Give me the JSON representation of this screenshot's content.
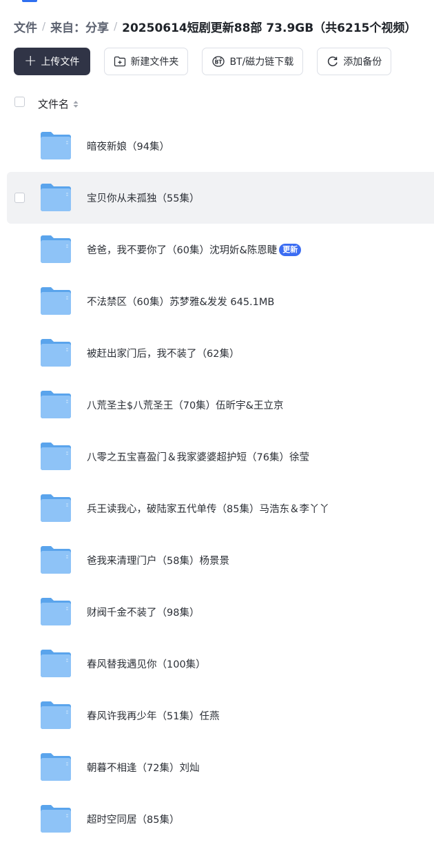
{
  "breadcrumb": {
    "root": "文件",
    "parent": "来自：分享",
    "current": "20250614短剧更新88部 73.9GB（共6215个视频）",
    "separator": "/"
  },
  "toolbar": {
    "upload_label": "上传文件",
    "new_folder_label": "新建文件夹",
    "bt_download_label": "BT/磁力链下载",
    "backup_label": "添加备份"
  },
  "list_header": {
    "name_label": "文件名"
  },
  "colors": {
    "folder": "#5aa4ec",
    "accent": "#2f6ff0",
    "primary_button": "#303446",
    "badge": "#3b6cf2"
  },
  "files": [
    {
      "name": "暗夜新娘（94集）",
      "badge": ""
    },
    {
      "name": "宝贝你从未孤独（55集）",
      "badge": ""
    },
    {
      "name": "爸爸，我不要你了（60集）沈玥妡&陈恩睫",
      "badge": "更新"
    },
    {
      "name": "不法禁区（60集）苏梦雅&发发 645.1MB",
      "badge": ""
    },
    {
      "name": "被赶出家门后，我不装了（62集）",
      "badge": ""
    },
    {
      "name": "八荒圣主$八荒圣王（70集）伍昕宇&王立京",
      "badge": ""
    },
    {
      "name": "八零之五宝喜盈门＆我家婆婆超护短（76集）徐莹",
      "badge": ""
    },
    {
      "name": "兵王读我心，破陆家五代单传（85集）马浩东＆李丫丫",
      "badge": ""
    },
    {
      "name": "爸我来清理门户（58集）杨景景",
      "badge": ""
    },
    {
      "name": "财阀千金不装了（98集）",
      "badge": ""
    },
    {
      "name": "春风替我遇见你（100集）",
      "badge": ""
    },
    {
      "name": "春风许我再少年（51集）任燕",
      "badge": ""
    },
    {
      "name": "朝暮不相逢（72集）刘灿",
      "badge": ""
    },
    {
      "name": "超时空同居（85集）",
      "badge": ""
    }
  ]
}
